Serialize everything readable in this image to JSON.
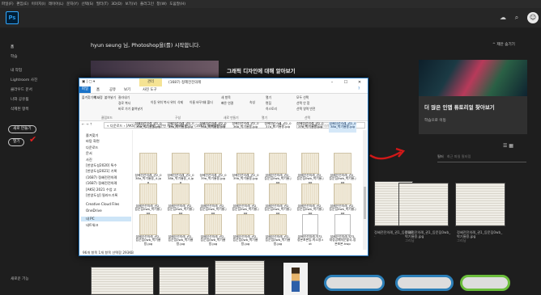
{
  "menubar": [
    "파일(F)",
    "편집(E)",
    "이미지(I)",
    "레이어(L)",
    "문자(Y)",
    "선택(S)",
    "필터(T)",
    "3D(D)",
    "보기(V)",
    "플러그인",
    "창(W)",
    "도움말(H)"
  ],
  "app": {
    "logo": "Ps"
  },
  "sidebar": {
    "items": [
      "홈",
      "학습",
      "내 작업",
      "Lightroom 사진",
      "클라우드 문서",
      "나와 공유됨",
      "삭제된 항목"
    ],
    "new_button": "새로 만들기",
    "open_button": "열기",
    "whats_new": "새로운 기능"
  },
  "home": {
    "greeting": "hyun seung 님, Photoshop을(를) 시작합니다.",
    "hide_label": "제안 숨기기",
    "learn_title": "그래픽 디자인에 대해 알아보기",
    "promo_title": "더 많은 인앱 튜토리얼 찾아보기",
    "promo_sub": "학습으로 이동",
    "filter_label": "필터",
    "filter_placeholder": "최근 파일 필터링"
  },
  "recent": [
    {
      "name": "정혜전전의례_권1_등문집0..",
      "sub": "-",
      "type": "JPEG"
    },
    {
      "name": "정혜전전의례_권1_등문집0wb_",
      "sub": "박기룡용.jpg",
      "type": "그리닝"
    },
    {
      "name": "정혜전전의례_권1_등문집0wb_",
      "sub": "박기룡용.jpg",
      "type": "그리닝"
    }
  ],
  "explorer": {
    "title": "(1687) 정혜전전의례",
    "manage_tab": "관리",
    "tabs": [
      "파일",
      "홈",
      "공유",
      "보기",
      "사진 도구"
    ],
    "ribbon": {
      "clipboard": [
        "즐겨찾기에 고정",
        "복사",
        "붙여넣기",
        "잘라내기",
        "경로 복사",
        "바로 가기 붙여넣기"
      ],
      "organize": [
        "이동 위치",
        "복사 위치",
        "삭제",
        "이름 바꾸기",
        "새 폴더"
      ],
      "new": [
        "새 항목",
        "빠른 연결"
      ],
      "open": [
        "속성",
        "열기",
        "편집",
        "히스토리"
      ],
      "select": [
        "모두 선택",
        "선택 안 함",
        "선택 영역 반전"
      ],
      "groups": [
        "클립보드",
        "구성",
        "새로 만들기",
        "열기",
        "선택"
      ]
    },
    "path": "« 다운로드 › [AKS] 2021년 수업 고문헌 자료 정보화 연구 › (1687) 정혜전전의례",
    "search_placeholder": "(1687) 정혜전전의례 검색",
    "nav": [
      "즐겨찾기",
      "바탕 화면",
      "다운로드",
      "문서",
      "사진",
      "[한양도성2020] 특수",
      "[한양도성2021] 기록",
      "(1687) 정혜전전의례",
      "(1687) 정혜전전의례",
      "[AKS] 2021 수업 고",
      "[한양도성] 필라드기록",
      "Creative Cloud Files",
      "OneDrive",
      "내 PC",
      "네트워크"
    ],
    "files": [
      "정혜전전의례_권2_035a_박기룡용.jpg",
      "정혜전전의례_권2_035b_박기룡용.jpg",
      "정혜전전의례_권2_036a_박기룡용.jpg",
      "정혜전전의례_권2_036b_박기룡용.jpg",
      "정혜전전의례_권2_037a_박기룡용.jpg",
      "정혜전전의례_권2_037b_박기룡용.jpg",
      "정혜전전의례_권2_038a_박기룡용.jpg",
      "정혜전전의례_권2_038a_박기룡용_4.jpg",
      "정혜전전의례_권2_038b_박기룡용_4.jpg",
      "정혜전전의례_권2_039a_박기룡용.jpg",
      "정혜전전의례_권2_039b_박기룡용.jpg",
      "정혜전전의례_권2_등문집0wb_박기룡.jpg",
      "정혜전전의례_권2_등문집0wb_박기룡.jpg",
      "정혜전전의례_권2_등문집0wb_박기룡.jpg",
      "정혜전전의례_권2_등문집0wb_박기룡.jpg",
      "정혜전전의례_권2_등문집0wb_박기룡.jpg",
      "정혜전전의례_권2_등문집0wb_박기룡.jpg",
      "정혜전전의례_권2_등문집0wb_박기룡.jpg",
      "정혜전전의례_권2_등문집0wb_박기룡.jpg",
      "정혜전전의례_권2_등문집0wb_박기룡.jpg",
      "정혜전전의례_권2_등문집0wb_박기룡.jpg",
      "정혜전전의례_권2_등문집0wb_박기룡용.jpg",
      "정혜전전의례_권2_등문집0wb_박기룡용.jpg",
      "정혜전전의례_권2_등문집0wb_박기룡용.jpg",
      "정혜전전의례_권2_등문집0wb_박기룡용.jpg",
      "정혜전전의례_권2_등문집0wb_박기룡용.jpg",
      "정혜전전의례-목차-정본초본등-박소영.txt",
      "정혜전전의례-목차-대정공폐의문할국-정본초본.hwp"
    ],
    "status": "96개 항목   1개 항목 선택함 293KB"
  },
  "colors": {
    "accent": "#31a8ff",
    "annotation": "#e02020",
    "explorer_manage": "#f5e394"
  }
}
